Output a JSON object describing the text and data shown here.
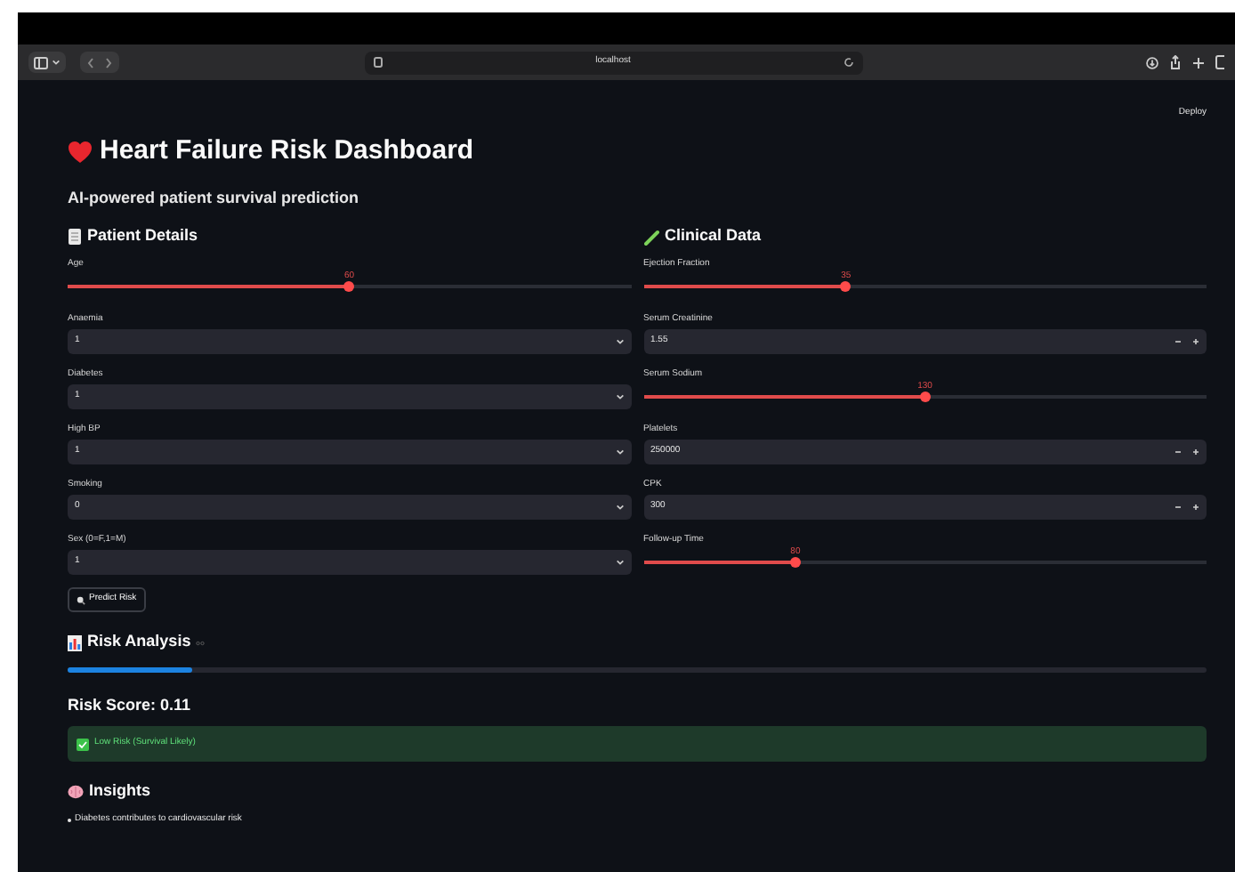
{
  "browser": {
    "address": "localhost"
  },
  "toolbar": {
    "deploy": "Deploy"
  },
  "title": "Heart Failure Risk Dashboard",
  "subtitle": "AI-powered patient survival prediction",
  "patient_details": {
    "heading": "Patient Details",
    "fields": [
      {
        "kind": "slider",
        "label": "Age",
        "value": "60",
        "level": 0.5
      },
      {
        "kind": "select",
        "label": "Anaemia",
        "value": "1"
      },
      {
        "kind": "select",
        "label": "Diabetes",
        "value": "1"
      },
      {
        "kind": "select",
        "label": "High BP",
        "value": "1"
      },
      {
        "kind": "select",
        "label": "Smoking",
        "value": "0"
      },
      {
        "kind": "select",
        "label": "Sex (0=F,1=M)",
        "value": "1"
      }
    ]
  },
  "clinical_data": {
    "heading": "Clinical Data",
    "fields": [
      {
        "kind": "slider",
        "label": "Ejection Fraction",
        "value": "35",
        "level": 0.36
      },
      {
        "kind": "number",
        "label": "Serum Creatinine",
        "value": "1.55"
      },
      {
        "kind": "slider",
        "label": "Serum Sodium",
        "value": "130",
        "level": 0.5
      },
      {
        "kind": "number",
        "label": "Platelets",
        "value": "250000"
      },
      {
        "kind": "number",
        "label": "CPK",
        "value": "300"
      },
      {
        "kind": "slider",
        "label": "Follow-up Time",
        "value": "80",
        "level": 0.27
      }
    ]
  },
  "predict_button": "Predict Risk",
  "risk_analysis": {
    "heading": "Risk Analysis",
    "progress": {
      "level": 0.11
    },
    "score": "Risk Score: 0.11",
    "alert": "Low Risk (Survival Likely)"
  },
  "insights": {
    "heading": "Insights",
    "items": [
      "Diabetes contributes to cardiovascular risk"
    ]
  }
}
